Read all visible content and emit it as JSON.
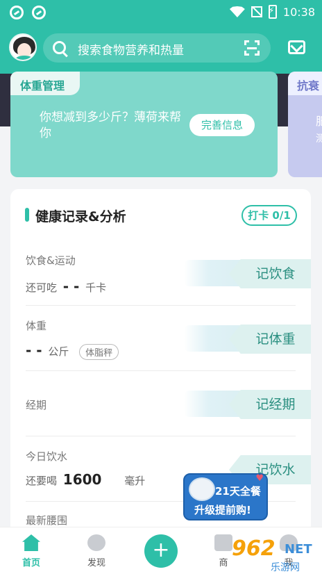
{
  "status_bar": {
    "time": "10:38"
  },
  "header": {
    "search_placeholder": "搜索食物营养和热量"
  },
  "banners": {
    "weight": {
      "tag": "体重管理",
      "message": "你想减到多少斤？薄荷来帮你",
      "button": "完善信息"
    },
    "second": {
      "tag": "抗衰",
      "line1": "肥",
      "line2": "测"
    }
  },
  "health_card": {
    "title": "健康记录&分析",
    "checkin": "打卡 0/1",
    "rows": [
      {
        "label": "饮食&运动",
        "value_prefix": "还可吃",
        "value": "- -",
        "unit": "千卡",
        "button": "记饮食"
      },
      {
        "label": "体重",
        "value": "- -",
        "unit": "公斤",
        "extra": "体脂秤",
        "button": "记体重"
      },
      {
        "label": "经期",
        "button": "记经期"
      },
      {
        "label": "今日饮水",
        "value_prefix": "还要喝",
        "value": "1600",
        "unit": "毫升",
        "button": "记饮水"
      },
      {
        "label": "最新腰围"
      }
    ]
  },
  "promo": {
    "line1": "21天全餐",
    "line2": "升级提前购!"
  },
  "tabbar": {
    "items": [
      {
        "label": "首页",
        "icon": "home-icon",
        "active": true
      },
      {
        "label": "发现",
        "icon": "chat-icon"
      },
      {
        "label": "商",
        "icon": "shop-icon"
      },
      {
        "label": "我",
        "icon": "profile-icon"
      }
    ],
    "add_symbol": "+"
  },
  "watermark": {
    "num": "962",
    "net": "NET",
    "cn": "乐游网"
  },
  "colors": {
    "accent": "#2ebfa8",
    "banner": "#7fd8cb",
    "promo": "#2b76c9"
  }
}
